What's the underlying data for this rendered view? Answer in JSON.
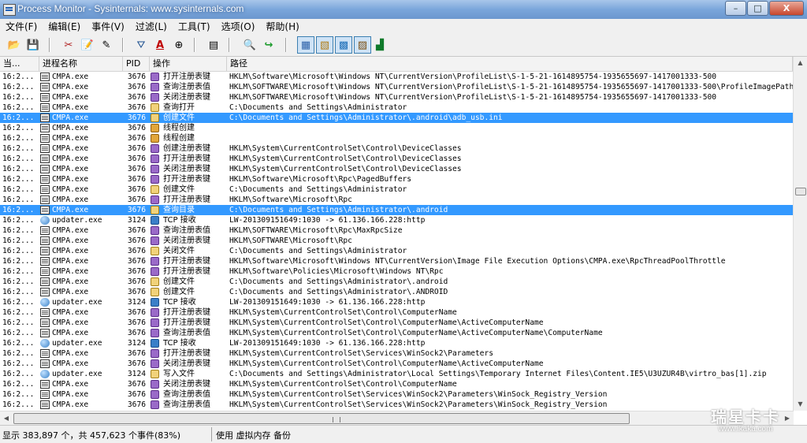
{
  "window": {
    "title": "Process Monitor - Sysinternals: www.sysinternals.com",
    "minimize": "–",
    "maximize": "□",
    "close": "X"
  },
  "menu": [
    "文件(F)",
    "编辑(E)",
    "事件(V)",
    "过滤(L)",
    "工具(T)",
    "选项(O)",
    "帮助(H)"
  ],
  "toolbar_icons": [
    {
      "name": "open-icon",
      "glyph": "📂"
    },
    {
      "name": "save-icon",
      "glyph": "💾"
    },
    {
      "name": "capture-icon",
      "glyph": "✂"
    },
    {
      "name": "autoscroll-icon",
      "glyph": "📝"
    },
    {
      "name": "clear-icon",
      "glyph": "✎"
    },
    {
      "name": "filter-icon",
      "glyph": "⛛"
    },
    {
      "name": "highlight-icon",
      "glyph": "A"
    },
    {
      "name": "target-icon",
      "glyph": "⊕"
    },
    {
      "name": "process-tree-icon",
      "glyph": "▤"
    },
    {
      "name": "find-icon",
      "glyph": "🔍"
    },
    {
      "name": "jump-icon",
      "glyph": "↪"
    },
    {
      "name": "show-registry-icon",
      "glyph": "▦"
    },
    {
      "name": "show-filesystem-icon",
      "glyph": "▧"
    },
    {
      "name": "show-network-icon",
      "glyph": "▩"
    },
    {
      "name": "show-process-icon",
      "glyph": "▨"
    },
    {
      "name": "show-profiling-icon",
      "glyph": "▟"
    }
  ],
  "columns": {
    "time": "当...",
    "process": "进程名称",
    "pid": "PID",
    "operation": "操作",
    "path": "路径"
  },
  "rows": [
    {
      "time": "16:2...",
      "pico": "doc",
      "proc": "CMPA.exe",
      "pid": "3676",
      "oico": "reg",
      "op": "打开注册表键",
      "path": "HKLM\\Software\\Microsoft\\Windows NT\\CurrentVersion\\ProfileList\\S-1-5-21-1614895754-1935655697-1417001333-500"
    },
    {
      "time": "16:2...",
      "pico": "doc",
      "proc": "CMPA.exe",
      "pid": "3676",
      "oico": "reg",
      "op": "查询注册表值",
      "path": "HKLM\\SOFTWARE\\Microsoft\\Windows NT\\CurrentVersion\\ProfileList\\S-1-5-21-1614895754-1935655697-1417001333-500\\ProfileImagePath"
    },
    {
      "time": "16:2...",
      "pico": "doc",
      "proc": "CMPA.exe",
      "pid": "3676",
      "oico": "reg",
      "op": "关闭注册表键",
      "path": "HKLM\\SOFTWARE\\Microsoft\\Windows NT\\CurrentVersion\\ProfileList\\S-1-5-21-1614895754-1935655697-1417001333-500"
    },
    {
      "time": "16:2...",
      "pico": "doc",
      "proc": "CMPA.exe",
      "pid": "3676",
      "oico": "file",
      "op": "查询打开",
      "path": "C:\\Documents and Settings\\Administrator"
    },
    {
      "time": "16:2...",
      "pico": "doc",
      "proc": "CMPA.exe",
      "pid": "3676",
      "oico": "file",
      "op": "创建文件",
      "path": "C:\\Documents and Settings\\Administrator\\.android\\adb_usb.ini",
      "sel": true
    },
    {
      "time": "16:2...",
      "pico": "doc",
      "proc": "CMPA.exe",
      "pid": "3676",
      "oico": "thread",
      "op": "线程创建",
      "path": ""
    },
    {
      "time": "16:2...",
      "pico": "doc",
      "proc": "CMPA.exe",
      "pid": "3676",
      "oico": "thread",
      "op": "线程创建",
      "path": ""
    },
    {
      "time": "16:2...",
      "pico": "doc",
      "proc": "CMPA.exe",
      "pid": "3676",
      "oico": "reg",
      "op": "创建注册表键",
      "path": "HKLM\\System\\CurrentControlSet\\Control\\DeviceClasses"
    },
    {
      "time": "16:2...",
      "pico": "doc",
      "proc": "CMPA.exe",
      "pid": "3676",
      "oico": "reg",
      "op": "打开注册表键",
      "path": "HKLM\\System\\CurrentControlSet\\Control\\DeviceClasses"
    },
    {
      "time": "16:2...",
      "pico": "doc",
      "proc": "CMPA.exe",
      "pid": "3676",
      "oico": "reg",
      "op": "关闭注册表键",
      "path": "HKLM\\System\\CurrentControlSet\\Control\\DeviceClasses"
    },
    {
      "time": "16:2...",
      "pico": "doc",
      "proc": "CMPA.exe",
      "pid": "3676",
      "oico": "reg",
      "op": "打开注册表键",
      "path": "HKLM\\Software\\Microsoft\\Rpc\\PagedBuffers"
    },
    {
      "time": "16:2...",
      "pico": "doc",
      "proc": "CMPA.exe",
      "pid": "3676",
      "oico": "file",
      "op": "创建文件",
      "path": "C:\\Documents and Settings\\Administrator"
    },
    {
      "time": "16:2...",
      "pico": "doc",
      "proc": "CMPA.exe",
      "pid": "3676",
      "oico": "reg",
      "op": "打开注册表键",
      "path": "HKLM\\Software\\Microsoft\\Rpc"
    },
    {
      "time": "16:2...",
      "pico": "doc",
      "proc": "CMPA.exe",
      "pid": "3676",
      "oico": "file",
      "op": "查询目录",
      "path": "C:\\Documents and Settings\\Administrator\\.android",
      "sel": true
    },
    {
      "time": "16:2...",
      "pico": "globe",
      "proc": "updater.exe",
      "pid": "3124",
      "oico": "net",
      "op": "TCP 接收",
      "path": "LW-201309151649:1030 -> 61.136.166.228:http"
    },
    {
      "time": "16:2...",
      "pico": "doc",
      "proc": "CMPA.exe",
      "pid": "3676",
      "oico": "reg",
      "op": "查询注册表值",
      "path": "HKLM\\SOFTWARE\\Microsoft\\Rpc\\MaxRpcSize"
    },
    {
      "time": "16:2...",
      "pico": "doc",
      "proc": "CMPA.exe",
      "pid": "3676",
      "oico": "reg",
      "op": "关闭注册表键",
      "path": "HKLM\\SOFTWARE\\Microsoft\\Rpc"
    },
    {
      "time": "16:2...",
      "pico": "doc",
      "proc": "CMPA.exe",
      "pid": "3676",
      "oico": "file",
      "op": "关闭文件",
      "path": "C:\\Documents and Settings\\Administrator"
    },
    {
      "time": "16:2...",
      "pico": "doc",
      "proc": "CMPA.exe",
      "pid": "3676",
      "oico": "reg",
      "op": "打开注册表键",
      "path": "HKLM\\Software\\Microsoft\\Windows NT\\CurrentVersion\\Image File Execution Options\\CMPA.exe\\RpcThreadPoolThrottle"
    },
    {
      "time": "16:2...",
      "pico": "doc",
      "proc": "CMPA.exe",
      "pid": "3676",
      "oico": "reg",
      "op": "打开注册表键",
      "path": "HKLM\\Software\\Policies\\Microsoft\\Windows NT\\Rpc"
    },
    {
      "time": "16:2...",
      "pico": "doc",
      "proc": "CMPA.exe",
      "pid": "3676",
      "oico": "file",
      "op": "创建文件",
      "path": "C:\\Documents and Settings\\Administrator\\.android"
    },
    {
      "time": "16:2...",
      "pico": "doc",
      "proc": "CMPA.exe",
      "pid": "3676",
      "oico": "file",
      "op": "创建文件",
      "path": "C:\\Documents and Settings\\Administrator\\.ANDROID"
    },
    {
      "time": "16:2...",
      "pico": "globe",
      "proc": "updater.exe",
      "pid": "3124",
      "oico": "net",
      "op": "TCP 接收",
      "path": "LW-201309151649:1030 -> 61.136.166.228:http"
    },
    {
      "time": "16:2...",
      "pico": "doc",
      "proc": "CMPA.exe",
      "pid": "3676",
      "oico": "reg",
      "op": "打开注册表键",
      "path": "HKLM\\System\\CurrentControlSet\\Control\\ComputerName"
    },
    {
      "time": "16:2...",
      "pico": "doc",
      "proc": "CMPA.exe",
      "pid": "3676",
      "oico": "reg",
      "op": "打开注册表键",
      "path": "HKLM\\System\\CurrentControlSet\\Control\\ComputerName\\ActiveComputerName"
    },
    {
      "time": "16:2...",
      "pico": "doc",
      "proc": "CMPA.exe",
      "pid": "3676",
      "oico": "reg",
      "op": "查询注册表值",
      "path": "HKLM\\System\\CurrentControlSet\\Control\\ComputerName\\ActiveComputerName\\ComputerName"
    },
    {
      "time": "16:2...",
      "pico": "globe",
      "proc": "updater.exe",
      "pid": "3124",
      "oico": "net",
      "op": "TCP 接收",
      "path": "LW-201309151649:1030 -> 61.136.166.228:http"
    },
    {
      "time": "16:2...",
      "pico": "doc",
      "proc": "CMPA.exe",
      "pid": "3676",
      "oico": "reg",
      "op": "打开注册表键",
      "path": "HKLM\\System\\CurrentControlSet\\Services\\WinSock2\\Parameters"
    },
    {
      "time": "16:2...",
      "pico": "doc",
      "proc": "CMPA.exe",
      "pid": "3676",
      "oico": "reg",
      "op": "关闭注册表键",
      "path": "HKLM\\System\\CurrentControlSet\\Control\\ComputerName\\ActiveComputerName"
    },
    {
      "time": "16:2...",
      "pico": "globe",
      "proc": "updater.exe",
      "pid": "3124",
      "oico": "file",
      "op": "写入文件",
      "path": "C:\\Documents and Settings\\Administrator\\Local Settings\\Temporary Internet Files\\Content.IE5\\U3UZUR4B\\virtro_bas[1].zip"
    },
    {
      "time": "16:2...",
      "pico": "doc",
      "proc": "CMPA.exe",
      "pid": "3676",
      "oico": "reg",
      "op": "关闭注册表键",
      "path": "HKLM\\System\\CurrentControlSet\\Control\\ComputerName"
    },
    {
      "time": "16:2...",
      "pico": "doc",
      "proc": "CMPA.exe",
      "pid": "3676",
      "oico": "reg",
      "op": "查询注册表值",
      "path": "HKLM\\System\\CurrentControlSet\\Services\\WinSock2\\Parameters\\WinSock_Registry_Version"
    },
    {
      "time": "16:2...",
      "pico": "doc",
      "proc": "CMPA.exe",
      "pid": "3676",
      "oico": "reg",
      "op": "查询注册表值",
      "path": "HKLM\\System\\CurrentControlSet\\Services\\WinSock2\\Parameters\\WinSock_Registry_Version"
    }
  ],
  "status": {
    "left": "显示 383,897 个，共 457,623 个事件(83%)",
    "right": "使用 虚拟内存 备份"
  },
  "watermark": {
    "line1": "瑞星卡卡",
    "line2": "www.ikaka.com"
  }
}
